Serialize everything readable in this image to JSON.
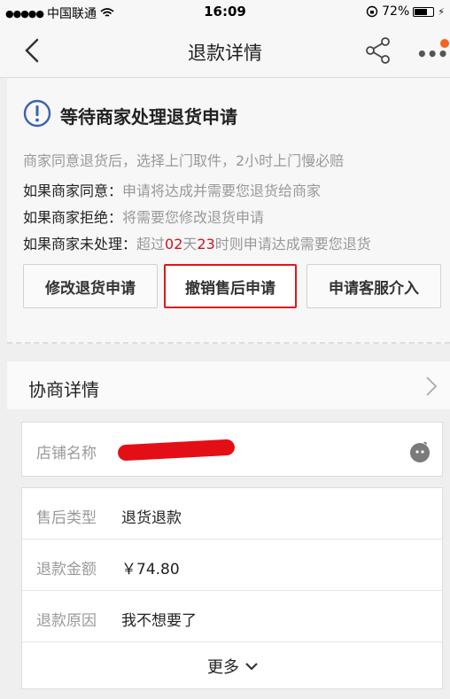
{
  "status_bar": {
    "carrier": "中国联通",
    "time": "16:09",
    "battery": "72%",
    "battery_level": 0.72
  },
  "nav": {
    "title": "退款详情"
  },
  "status": {
    "title": "等待商家处理退货申请",
    "hint": "商家同意退货后，选择上门取件，2小时上门慢必赔",
    "lines": [
      {
        "label": "如果商家同意：",
        "text": "申请将达成并需要您退货给商家"
      },
      {
        "label": "如果商家拒绝：",
        "text": "将需要您修改退货申请"
      },
      {
        "label": "如果商家未处理：",
        "text_prefix": "超过",
        "days": "02",
        "day_unit": "天",
        "hours": "23",
        "text_suffix": "时则申请达成需要您退货"
      }
    ],
    "buttons": {
      "modify": "修改退货申请",
      "cancel": "撤销售后申请",
      "service": "申请客服介入"
    }
  },
  "negotiation": {
    "title": "协商详情"
  },
  "store": {
    "label": "店铺名称"
  },
  "details": {
    "rows": [
      {
        "label": "售后类型",
        "value": "退货退款"
      },
      {
        "label": "退款金额",
        "value": "￥74.80"
      },
      {
        "label": "退款原因",
        "value": "我不想要了"
      }
    ],
    "more": "更多"
  },
  "colors": {
    "accent_red": "#d0121b",
    "highlight_border": "#e0151c",
    "info_blue": "#3a63b0"
  }
}
